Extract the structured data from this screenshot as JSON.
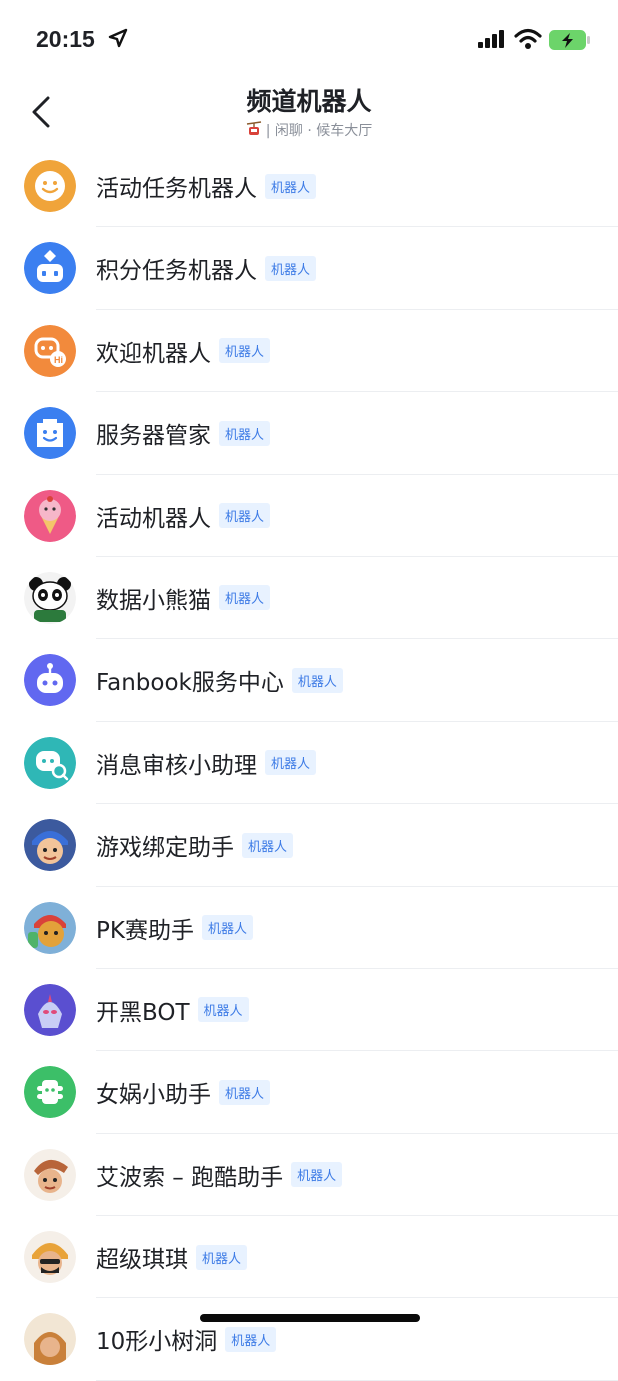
{
  "status_bar": {
    "time": "20:15"
  },
  "header": {
    "title": "频道机器人",
    "subtitle": "| 闲聊 · 候车大厅"
  },
  "badge_label": "机器人",
  "bots": [
    {
      "name": "活动任务机器人",
      "avatar": "smiley-avatar",
      "color": "#f0a43a"
    },
    {
      "name": "积分任务机器人",
      "avatar": "robot-avatar",
      "color": "#3b7ff0"
    },
    {
      "name": "欢迎机器人",
      "avatar": "hi-bot-avatar",
      "color": "#f28a3c"
    },
    {
      "name": "服务器管家",
      "avatar": "butler-avatar",
      "color": "#3b7ff0"
    },
    {
      "name": "活动机器人",
      "avatar": "icecream-avatar",
      "color": "#ef5a86"
    },
    {
      "name": "数据小熊猫",
      "avatar": "panda-avatar",
      "color": "#2c7a3c"
    },
    {
      "name": "Fanbook服务中心",
      "avatar": "service-bot-avatar",
      "color": "#6168f0"
    },
    {
      "name": "消息审核小助理",
      "avatar": "review-bot-avatar",
      "color": "#2fb7b6"
    },
    {
      "name": "游戏绑定助手",
      "avatar": "game-character-avatar",
      "color": "#3c5a9e"
    },
    {
      "name": "PK赛助手",
      "avatar": "pk-character-avatar",
      "color": "#e3a23a"
    },
    {
      "name": "开黑BOT",
      "avatar": "hero-avatar",
      "color": "#5a4fd0"
    },
    {
      "name": "女娲小助手",
      "avatar": "nuwa-avatar",
      "color": "#3cbf68"
    },
    {
      "name": "艾波索 – 跑酷助手",
      "avatar": "runner-avatar",
      "color": "#b8653a"
    },
    {
      "name": "超级琪琪",
      "avatar": "qiqi-avatar",
      "color": "#e8a33a"
    },
    {
      "name": "10形小树洞",
      "avatar": "tree-avatar",
      "color": "#c9803a"
    }
  ]
}
